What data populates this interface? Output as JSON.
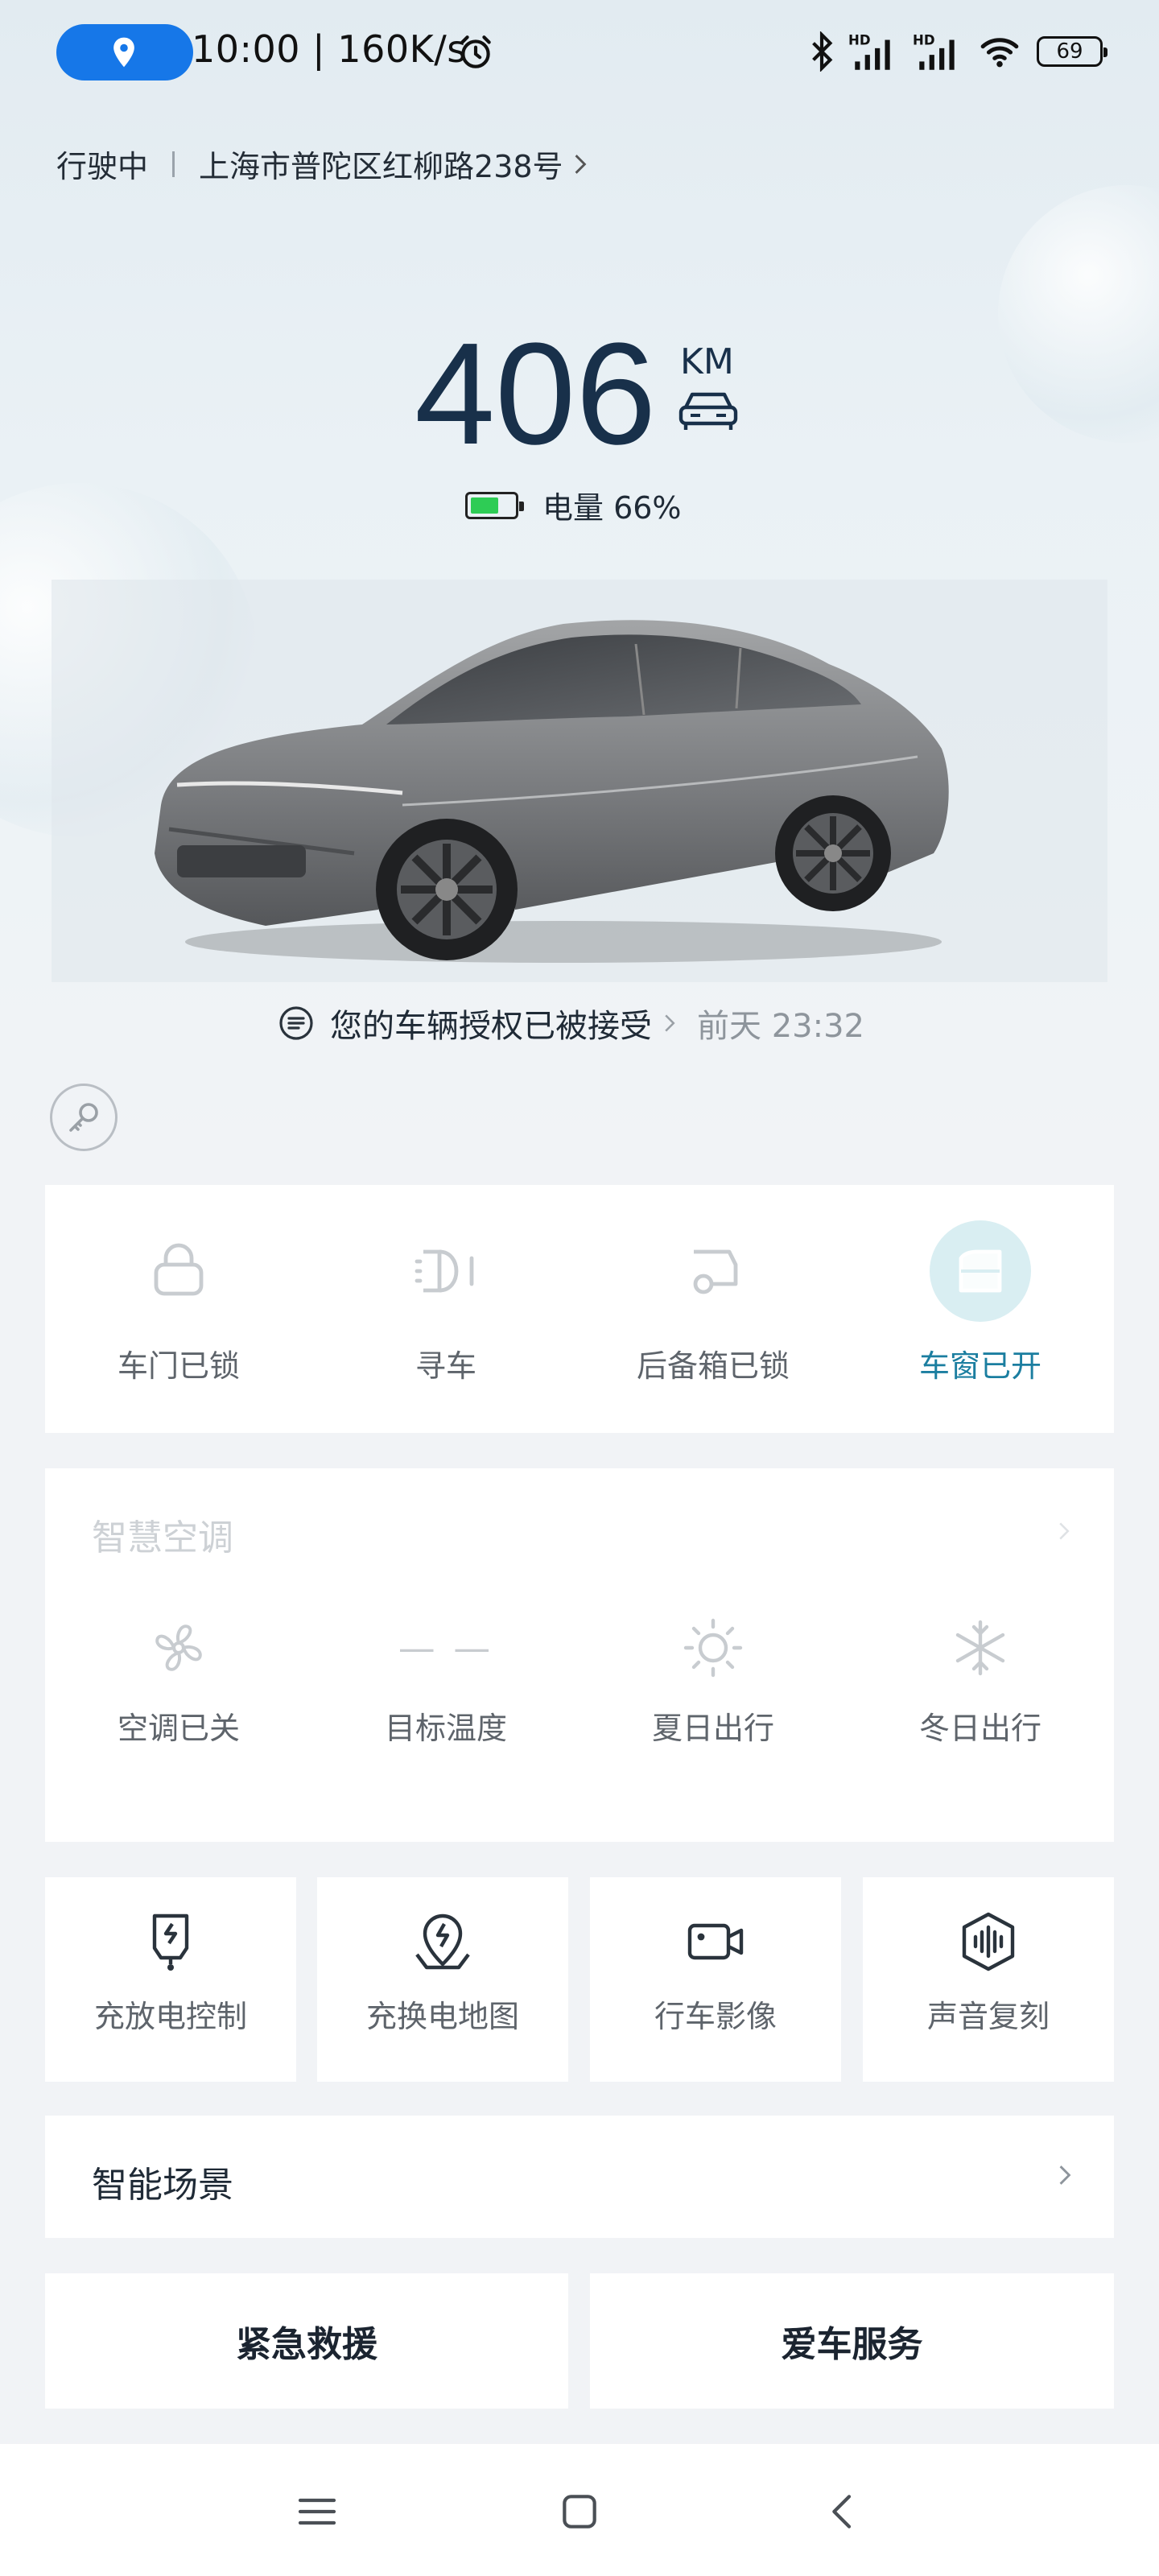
{
  "status_bar": {
    "time": "10:00 | 160K/s",
    "battery": "69",
    "icons": [
      "location-pin-icon",
      "alarm-icon",
      "bluetooth-icon",
      "signal-hd-icon",
      "signal-hd-icon",
      "wifi-icon",
      "battery-icon"
    ]
  },
  "location": {
    "status": "行驶中",
    "address": "上海市普陀区红柳路238号"
  },
  "range": {
    "value": "406",
    "unit": "KM",
    "battery_label": "电量 66%",
    "battery_level": 0.66
  },
  "notice": {
    "text": "您的车辆授权已被接受",
    "time": "前天 23:32"
  },
  "controls": [
    {
      "label": "车门已锁",
      "icon": "lock-icon",
      "active": false
    },
    {
      "label": "寻车",
      "icon": "headlight-icon",
      "active": false
    },
    {
      "label": "后备箱已锁",
      "icon": "trunk-icon",
      "active": false
    },
    {
      "label": "车窗已开",
      "icon": "window-icon",
      "active": true
    }
  ],
  "climate": {
    "title": "智慧空调",
    "items": [
      {
        "label": "空调已关",
        "icon": "fan-icon"
      },
      {
        "label": "目标温度",
        "icon": "dash-icon",
        "value": "— —"
      },
      {
        "label": "夏日出行",
        "icon": "sun-icon"
      },
      {
        "label": "冬日出行",
        "icon": "snowflake-icon"
      }
    ]
  },
  "tiles": [
    {
      "label": "充放电控制",
      "icon": "charge-control-icon"
    },
    {
      "label": "充换电地图",
      "icon": "charge-map-icon"
    },
    {
      "label": "行车影像",
      "icon": "camera-icon"
    },
    {
      "label": "声音复刻",
      "icon": "voice-icon"
    }
  ],
  "scene": {
    "label": "智能场景"
  },
  "bottom_buttons": {
    "rescue": "紧急救援",
    "service": "爱车服务"
  },
  "colors": {
    "accent": "#1b7ea0",
    "active_bg": "#d9eef2",
    "battery_green": "#2ecc55",
    "pill_blue": "#1677e8"
  }
}
